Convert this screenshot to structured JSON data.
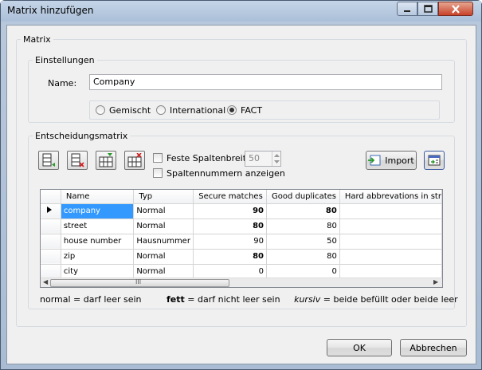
{
  "window": {
    "title": "Matrix hinzufügen"
  },
  "matrix_group": {
    "legend": "Matrix"
  },
  "settings": {
    "legend": "Einstellungen",
    "name_label": "Name:",
    "name_value": "Company",
    "radios": [
      {
        "label": "Gemischt",
        "checked": false
      },
      {
        "label": "International",
        "checked": false
      },
      {
        "label": "FACT",
        "checked": true
      }
    ]
  },
  "decision": {
    "legend": "Entscheidungsmatrix",
    "fixed_width_label": "Feste Spaltenbreite",
    "fixed_width_value": "50",
    "show_numbers_label": "Spaltennummern anzeigen",
    "import_label": "Import"
  },
  "table": {
    "headers": [
      "Name",
      "Typ",
      "Secure matches",
      "Good duplicates",
      "Hard abbrevations in str"
    ],
    "rows": [
      {
        "name": "company",
        "typ": "Normal",
        "secure": "90",
        "good": "80",
        "secure_bold": true,
        "good_bold": true,
        "current": true
      },
      {
        "name": "street",
        "typ": "Normal",
        "secure": "80",
        "good": "80",
        "secure_bold": true,
        "good_bold": false,
        "current": false
      },
      {
        "name": "house number",
        "typ": "Hausnummer",
        "secure": "90",
        "good": "50",
        "secure_bold": false,
        "good_bold": false,
        "current": false
      },
      {
        "name": "zip",
        "typ": "Normal",
        "secure": "80",
        "good": "80",
        "secure_bold": true,
        "good_bold": false,
        "current": false
      },
      {
        "name": "city",
        "typ": "Normal",
        "secure": "0",
        "good": "0",
        "secure_bold": false,
        "good_bold": false,
        "current": false
      }
    ]
  },
  "legend_text": {
    "normal": "normal = darf leer sein",
    "bold": "fett",
    "bold_rest": "= darf nicht leer sein",
    "italic": "kursiv",
    "italic_rest": "= beide befüllt oder beide leer"
  },
  "buttons": {
    "ok": "OK",
    "cancel": "Abbrechen"
  },
  "scroll_thumb_glyph": "III"
}
